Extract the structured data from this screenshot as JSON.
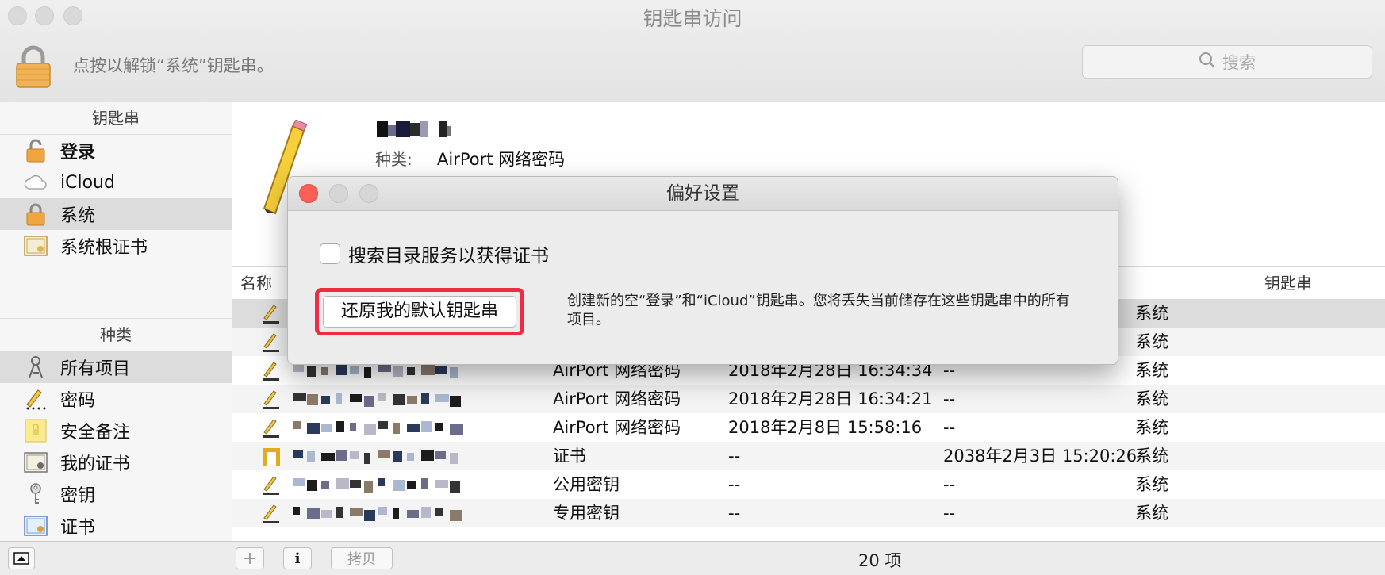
{
  "window": {
    "title": "钥匙串访问"
  },
  "toolbar": {
    "unlock_hint": "点按以解锁“系统”钥匙串。",
    "search_placeholder": "搜索"
  },
  "sidebar": {
    "keychains_header": "钥匙串",
    "keychains": [
      {
        "label": "登录",
        "icon": "lock-open-icon",
        "bold": true
      },
      {
        "label": "iCloud",
        "icon": "cloud-icon"
      },
      {
        "label": "系统",
        "icon": "lock-icon",
        "selected": true
      },
      {
        "label": "系统根证书",
        "icon": "certificate-icon"
      }
    ],
    "categories_header": "种类",
    "categories": [
      {
        "label": "所有项目",
        "icon": "all-items-icon",
        "selected": true
      },
      {
        "label": "密码",
        "icon": "password-icon"
      },
      {
        "label": "安全备注",
        "icon": "secure-note-icon"
      },
      {
        "label": "我的证书",
        "icon": "my-certificate-icon"
      },
      {
        "label": "密钥",
        "icon": "key-icon"
      },
      {
        "label": "证书",
        "icon": "certificate-icon"
      }
    ]
  },
  "detail": {
    "kind_label": "种类:",
    "kind_value": "AirPort 网络密码"
  },
  "table": {
    "columns": {
      "name": "名称",
      "keychain": "钥匙串"
    },
    "rows": [
      {
        "kind": "",
        "date": "",
        "expires": "",
        "keychain": "系统"
      },
      {
        "kind": "",
        "date": "",
        "expires": "",
        "keychain": "系统"
      },
      {
        "kind": "AirPort 网络密码",
        "date": "2018年2月28日 16:34:34",
        "expires": "--",
        "keychain": "系统"
      },
      {
        "kind": "AirPort 网络密码",
        "date": "2018年2月28日 16:34:21",
        "expires": "--",
        "keychain": "系统"
      },
      {
        "kind": "AirPort 网络密码",
        "date": "2018年2月8日 15:58:16",
        "expires": "--",
        "keychain": "系统"
      },
      {
        "kind": "证书",
        "date": "--",
        "expires": "2038年2月3日 15:20:26",
        "keychain": "系统"
      },
      {
        "kind": "公用密钥",
        "date": "--",
        "expires": "--",
        "keychain": "系统"
      },
      {
        "kind": "专用密钥",
        "date": "--",
        "expires": "--",
        "keychain": "系统"
      }
    ]
  },
  "statusbar": {
    "copy_label": "拷贝",
    "info_label": "i",
    "add_label": "+",
    "count": "20 项"
  },
  "modal": {
    "title": "偏好设置",
    "checkbox_label": "搜索目录服务以获得证书",
    "reset_button": "还原我的默认钥匙串",
    "reset_description": "创建新的空“登录”和“iCloud”钥匙串。您将丢失当前储存在这些钥匙串中的所有项目。"
  }
}
